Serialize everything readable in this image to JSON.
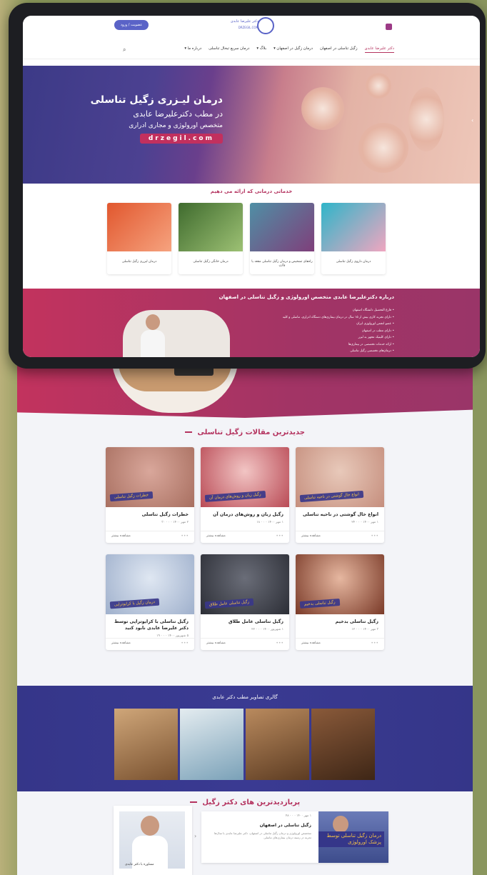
{
  "topbar": {
    "login_label": "عضویت / ورود",
    "logo_title": "دکتر علیرضا عابدی",
    "logo_sub": "DRZEGIL.COM"
  },
  "nav": {
    "items": [
      {
        "label": "دکتر علیرضا عابدی",
        "active": true
      },
      {
        "label": "زگیل تناسلی در اصفهان"
      },
      {
        "label": "درمان زگیل در اصفهان ▾"
      },
      {
        "label": "بلاگ ▾"
      },
      {
        "label": "درمان سریع تبخال تناسلی"
      },
      {
        "label": "درباره ما ▾"
      }
    ]
  },
  "hero": {
    "line1": "درمان لیـزری زگیل تناسلی",
    "line2": "در مطب دکترعلیرضا عابدی",
    "line3": "متخصص اورولوژی و مجاری ادراری",
    "url": "drzegil.com"
  },
  "services": {
    "title": "خدماتی درمانی که ارائه می دهیم",
    "cards": [
      {
        "label": "درمان لیزری زگیل تناسلی",
        "color_a": "#e1572e",
        "color_b": "#f6a37f"
      },
      {
        "label": "درمان خانگی زگیل تناسلی",
        "color_a": "#3f6b2e",
        "color_b": "#9dc174"
      },
      {
        "label": "راه‌های تشخیص و درمان زگیل تناسلی مقعد یا واژن",
        "color_a": "#4f8fa5",
        "color_b": "#7f3f7b"
      },
      {
        "label": "درمان داروی زگیل تناسلی",
        "color_a": "#2eb5c9",
        "color_b": "#f0a6c0"
      }
    ]
  },
  "about": {
    "title": "درباره دکترعلیرضا عابدی متخصص اورولوژی و زگیل تناسلی در اصفهان",
    "items": [
      "• فارغ التحصیل دانشگاه اصفهان",
      "• دارای تجربه کاری بیش از ۱۵ سال در درمان بیماری‌های دستگاه ادراری، تناسلی و کلیه",
      "• عضو انجمن اورولوژی ایران",
      "• دارای مطب در اصفهان",
      "• دارای کلینیک مجهز به لیزر",
      "• ارائه خدمات تخصصی در بیماری‌ها",
      "• درمان‌های تخصصی زگیل تناسلی"
    ],
    "extra_line": "• دارای پروتکل‌های بین المللی در درمان"
  },
  "articles": {
    "title": "جدیدترین مقالات زگیل تناسلی",
    "more_label": "مشاهده بیشتر",
    "items": [
      {
        "title": "انواع خال گوشتی در ناحیه تناسلی",
        "banner": "انواع خال گوشتی در ناحیه تناسلی",
        "meta": "۱ مهر ۱۴۰۰ · ۰ · ۲۴",
        "c1": "#e8c9ba",
        "c2": "#c58e7d"
      },
      {
        "title": "زگیل زبان و روش‌های درمان آن",
        "banner": "زگیل زبان و روش‌های درمان آن",
        "meta": "۱ مهر ۱۴۰۰ · ۰ · ۱۸",
        "c1": "#f2c5c4",
        "c2": "#b94a55"
      },
      {
        "title": "خطرات زگیل تناسلی",
        "banner": "خطرات زگیل تناسلی",
        "meta": "۲ مهر ۱۴۰۰ · ۰ · ۳۰",
        "c1": "#d9a79b",
        "c2": "#a86f60"
      },
      {
        "title": "زگیل تناسلی بدخیم",
        "banner": "زگیل تناسلی بدخیم",
        "meta": "۳ مهر ۱۴۰۰ · ۰ · ۱۲",
        "c1": "#e6b7a0",
        "c2": "#7a3a28"
      },
      {
        "title": "زگیل تناسلی عامل طلاق",
        "banner": "زگیل تناسلی عامل طلاق",
        "meta": "۱ شهریور ۱۴۰۰ · ۰ · ۲۲",
        "c1": "#6a6d78",
        "c2": "#2c2e36"
      },
      {
        "title": "زگیل تناسلی با کرایوتراپی توسط دکتر علیرضا عابدی نابود کنید",
        "banner": "درمان زگیل با کرایوتراپی",
        "meta": "۵ شهریور ۱۴۰۰ · ۰ · ۱۹",
        "c1": "#dfe7f2",
        "c2": "#9fb0cc"
      }
    ]
  },
  "gallery": {
    "title": "گالری تصاویر مطب دکتر عابدی",
    "images": [
      {
        "c1": "#cfa679",
        "c2": "#7a5230"
      },
      {
        "c1": "#e4ecf0",
        "c2": "#7aa1b8"
      },
      {
        "c1": "#b98a5e",
        "c2": "#5d3c22"
      },
      {
        "c1": "#8a5a3a",
        "c2": "#3e2616"
      }
    ]
  },
  "visited": {
    "title": "پربازدیدترین های دکتر زگیل",
    "profile_caption": "مشاوره با دکتر عابدی",
    "post_title": "زگیل تناسلی در اصفهان",
    "post_meta": "۱ مهر ۱۴۰۰ · ۰ · ۴۸",
    "post_desc": "متخصص اورولوژی و درمان زگیل تناسلی در اصفهان، دکتر علیرضا عابدی با سال‌ها تجربه در زمینه درمان بیماری‌های تناسلی",
    "thumb_tag": "درمان زگیل تناسلی توسط پزشک اورولوژی"
  }
}
